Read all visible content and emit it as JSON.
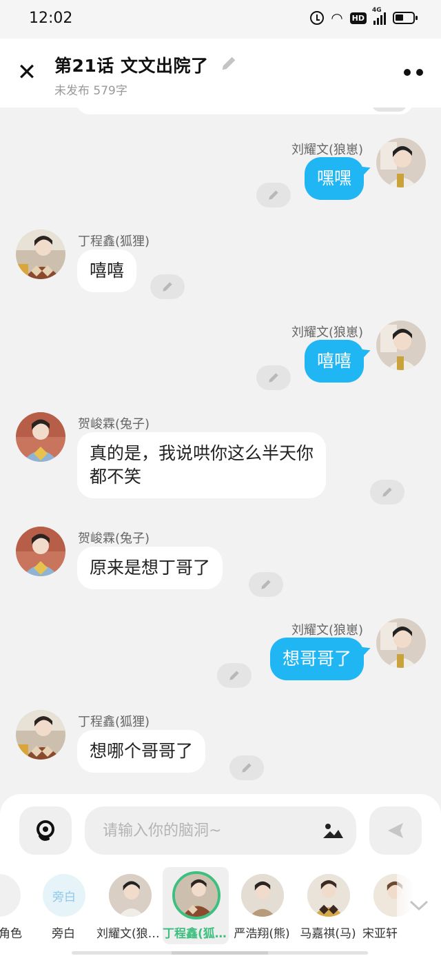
{
  "status_bar": {
    "time": "12:02",
    "network": "4G",
    "hd": "HD"
  },
  "header": {
    "title": "第21话   文文出院了",
    "subtitle": "未发布 579字"
  },
  "messages": [
    {
      "side": "right",
      "name": "刘耀文(狼崽)",
      "text": "嘿嘿",
      "avatar": "wen"
    },
    {
      "side": "left",
      "name": "丁程鑫(狐狸)",
      "text": "嘻嘻",
      "avatar": "ding"
    },
    {
      "side": "right",
      "name": "刘耀文(狼崽)",
      "text": "嘻嘻",
      "avatar": "wen"
    },
    {
      "side": "left",
      "name": "贺峻霖(兔子)",
      "text_line1": "真的是，我说哄你这么半天你",
      "text_line2": "都不笑",
      "avatar": "he"
    },
    {
      "side": "left",
      "name": "贺峻霖(兔子)",
      "text": "原来是想丁哥了",
      "avatar": "he"
    },
    {
      "side": "right",
      "name": "刘耀文(狼崽)",
      "text": "想哥哥了",
      "avatar": "wen"
    },
    {
      "side": "left",
      "name": "丁程鑫(狐狸)",
      "text": "想哪个哥哥了",
      "avatar": "ding"
    }
  ],
  "input": {
    "placeholder": "请输入你的脑洞~"
  },
  "roles": [
    {
      "name": "角色",
      "label": ""
    },
    {
      "name": "旁白",
      "label": "旁白"
    },
    {
      "name": "刘耀文(狼崽)"
    },
    {
      "name": "丁程鑫(狐狸)",
      "selected": true
    },
    {
      "name": "严浩翔(熊)"
    },
    {
      "name": "马嘉祺(马)"
    },
    {
      "name": "宋亚轩"
    }
  ],
  "colors": {
    "accent_blue": "#20b6f4",
    "selected_green": "#3fbf7f",
    "bg": "#f2f2f2"
  },
  "icons": [
    "close-icon",
    "edit-pencil-icon",
    "more-icon",
    "voice-icon",
    "image-icon",
    "send-icon",
    "chevron-down-icon"
  ]
}
